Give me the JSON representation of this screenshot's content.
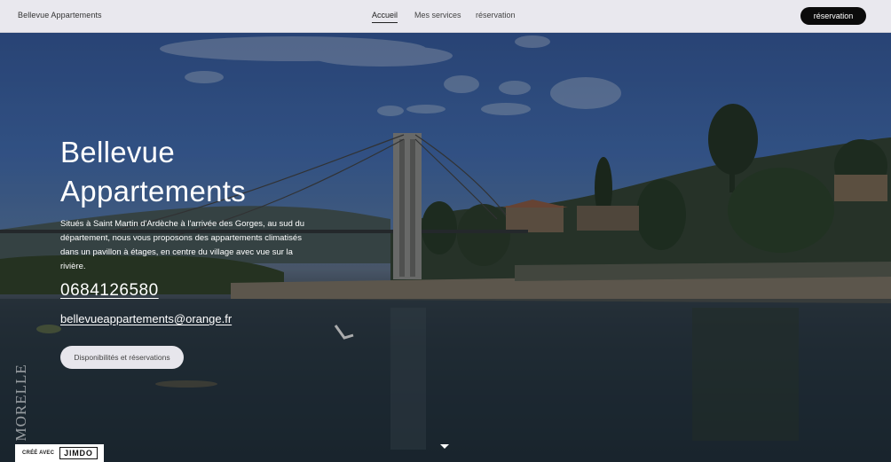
{
  "header": {
    "brand": "Bellevue Appartements",
    "nav": [
      {
        "label": "Accueil",
        "active": true
      },
      {
        "label": "Mes services",
        "active": false
      },
      {
        "label": "réservation",
        "active": false
      }
    ],
    "cta_label": "réservation"
  },
  "hero": {
    "title_line1": "Bellevue",
    "title_line2": "Appartements",
    "description": "Situés à Saint Martin d'Ardèche à l'arrivée des Gorges, au sud du département, nous vous proposons des appartements climatisés dans un pavillon à étages, en centre du village avec vue sur la rivière.",
    "phone": "0684126580",
    "email": "bellevueappartements@orange.fr",
    "button_label": "Disponibilités et réservations",
    "watermark": "ic MORELLE"
  },
  "footer_badge": {
    "prefix": "CRÉÉ AVEC",
    "logo": "JIMDO"
  },
  "colors": {
    "header_bg": "#e9e8ee",
    "cta_bg": "#0b0b0b",
    "hero_text": "#ffffff",
    "button_bg": "#e7e6ec"
  },
  "icons": {
    "scroll": "chevron-down-icon"
  }
}
